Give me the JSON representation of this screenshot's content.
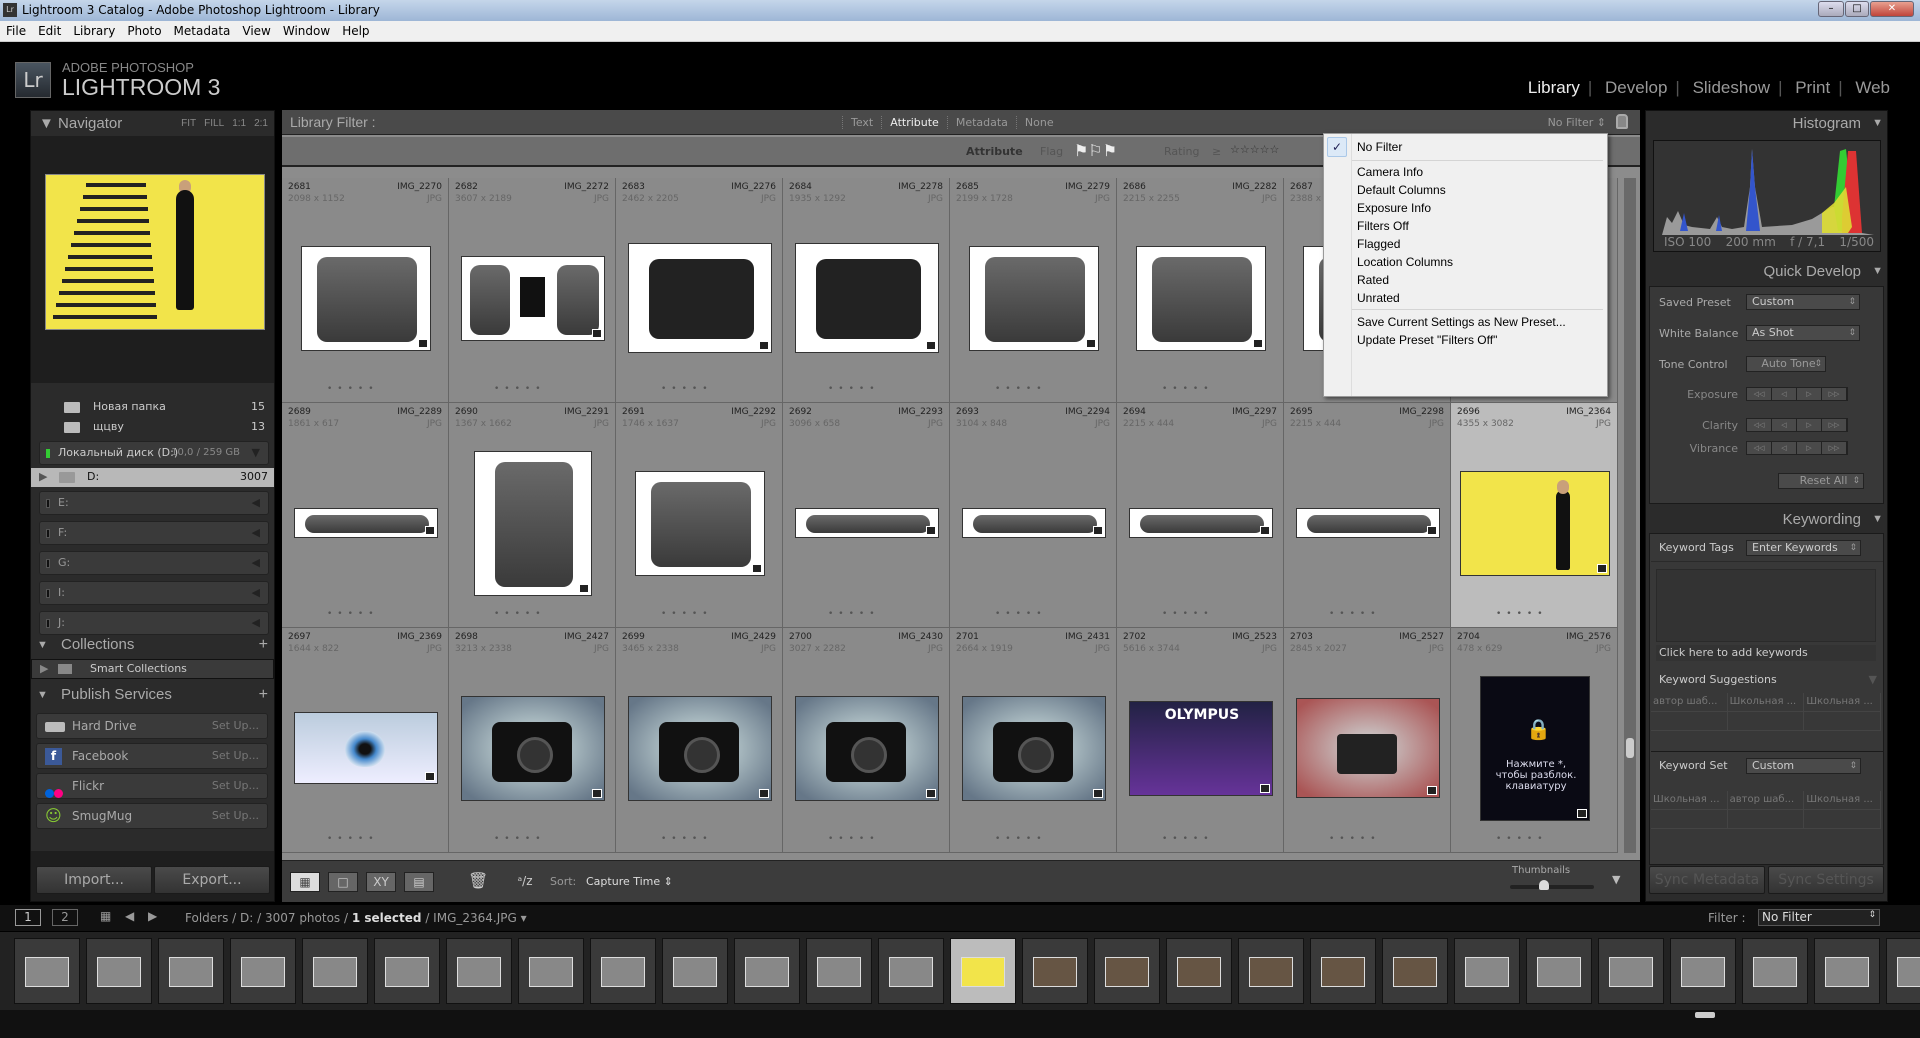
{
  "window": {
    "title": "Lightroom 3 Catalog - Adobe Photoshop Lightroom - Library",
    "icon": "Lr"
  },
  "menubar": [
    "File",
    "Edit",
    "Library",
    "Photo",
    "Metadata",
    "View",
    "Window",
    "Help"
  ],
  "brand": {
    "logo": "Lr",
    "line1": "ADOBE PHOTOSHOP",
    "line2": "LIGHTROOM 3"
  },
  "modules": [
    {
      "label": "Library",
      "active": true
    },
    {
      "label": "Develop"
    },
    {
      "label": "Slideshow"
    },
    {
      "label": "Print"
    },
    {
      "label": "Web"
    }
  ],
  "navigator": {
    "title": "Navigator",
    "zoom": [
      "FIT",
      "FILL",
      "1:1",
      "2:1"
    ]
  },
  "folders": [
    {
      "label": "Новая папка",
      "count": "15"
    },
    {
      "label": "щцву",
      "count": "13"
    }
  ],
  "volume": {
    "label": "Локальный диск (D:)",
    "space": "10,0 / 259 GB"
  },
  "folder_d": {
    "label": "D:",
    "count": "3007"
  },
  "drives": [
    "E:",
    "F:",
    "G:",
    "I:",
    "J:"
  ],
  "collections": {
    "title": "Collections",
    "items": [
      "Smart Collections"
    ]
  },
  "publish": {
    "title": "Publish Services",
    "setup": "Set Up...",
    "items": [
      "Hard Drive",
      "Facebook",
      "Flickr",
      "SmugMug"
    ]
  },
  "left_buttons": {
    "import": "Import...",
    "export": "Export..."
  },
  "filter": {
    "title": "Library Filter :",
    "tabs": [
      "Text",
      "Attribute",
      "Metadata",
      "None"
    ],
    "active_tab": "Attribute",
    "preset": "No Filter",
    "attribute_label": "Attribute",
    "flag_label": "Flag",
    "rating_label": "Rating",
    "rating_op": "≥"
  },
  "filter_menu": {
    "checked": "No Filter",
    "items": [
      "No Filter",
      "Camera Info",
      "Default Columns",
      "Exposure Info",
      "Filters Off",
      "Flagged",
      "Location Columns",
      "Rated",
      "Unrated",
      "Save Current Settings as New Preset...",
      "Update Preset \"Filters Off\""
    ]
  },
  "grid": [
    {
      "index": "2681",
      "name": "IMG_2270",
      "dims": "2098 x 1152",
      "ext": "JPG",
      "kind": "phone-back"
    },
    {
      "index": "2682",
      "name": "IMG_2272",
      "dims": "3607 x 2189",
      "ext": "JPG",
      "kind": "phone-parts"
    },
    {
      "index": "2683",
      "name": "IMG_2276",
      "dims": "2462 x 2205",
      "ext": "JPG",
      "kind": "phone-front"
    },
    {
      "index": "2684",
      "name": "IMG_2278",
      "dims": "1935 x 1292",
      "ext": "JPG",
      "kind": "phone-front"
    },
    {
      "index": "2685",
      "name": "IMG_2279",
      "dims": "2199 x 1728",
      "ext": "JPG",
      "kind": "phone-back"
    },
    {
      "index": "2686",
      "name": "IMG_2282",
      "dims": "2215 x 2255",
      "ext": "JPG",
      "kind": "phone-back"
    },
    {
      "index": "2687",
      "name": "",
      "dims": "2388 x",
      "ext": "",
      "kind": "phone-back"
    },
    {
      "index": "",
      "name": "",
      "dims": "",
      "ext": "",
      "kind": "none"
    },
    {
      "index": "2689",
      "name": "IMG_2289",
      "dims": "1861 x 617",
      "ext": "JPG",
      "kind": "phone-side"
    },
    {
      "index": "2690",
      "name": "IMG_2291",
      "dims": "1367 x 1662",
      "ext": "JPG",
      "kind": "phone-tall"
    },
    {
      "index": "2691",
      "name": "IMG_2292",
      "dims": "1746 x 1637",
      "ext": "JPG",
      "kind": "phone-back"
    },
    {
      "index": "2692",
      "name": "IMG_2293",
      "dims": "3096 x 658",
      "ext": "JPG",
      "kind": "phone-side"
    },
    {
      "index": "2693",
      "name": "IMG_2294",
      "dims": "3104 x 848",
      "ext": "JPG",
      "kind": "phone-side"
    },
    {
      "index": "2694",
      "name": "IMG_2297",
      "dims": "2215 x 444",
      "ext": "JPG",
      "kind": "phone-side"
    },
    {
      "index": "2695",
      "name": "IMG_2298",
      "dims": "2215 x 444",
      "ext": "JPG",
      "kind": "phone-side"
    },
    {
      "index": "2696",
      "name": "IMG_2364",
      "dims": "4355 x 3082",
      "ext": "JPG",
      "kind": "yellow",
      "selected": true
    },
    {
      "index": "2697",
      "name": "IMG_2369",
      "dims": "1644 x 822",
      "ext": "JPG",
      "kind": "eye"
    },
    {
      "index": "2698",
      "name": "IMG_2427",
      "dims": "3213 x 2338",
      "ext": "JPG",
      "kind": "camera"
    },
    {
      "index": "2699",
      "name": "IMG_2429",
      "dims": "3465 x 2338",
      "ext": "JPG",
      "kind": "camera"
    },
    {
      "index": "2700",
      "name": "IMG_2430",
      "dims": "3027 x 2282",
      "ext": "JPG",
      "kind": "camera"
    },
    {
      "index": "2701",
      "name": "IMG_2431",
      "dims": "2664 x 1919",
      "ext": "JPG",
      "kind": "camera"
    },
    {
      "index": "2702",
      "name": "IMG_2523",
      "dims": "5616 x 3744",
      "ext": "JPG",
      "kind": "olympus",
      "caption": "OLYMPUS"
    },
    {
      "index": "2703",
      "name": "IMG_2527",
      "dims": "2845 x 2027",
      "ext": "JPG",
      "kind": "camera-table"
    },
    {
      "index": "2704",
      "name": "IMG_2576",
      "dims": "478 x 629",
      "ext": "JPG",
      "kind": "lockscreen",
      "caption": "Нажмите *, чтобы разблок. клавиатуру"
    }
  ],
  "toolbar": {
    "sort_label": "Sort:",
    "sort_value": "Capture Time",
    "thumbnails_label": "Thumbnails",
    "thumbnail_size": 0.4
  },
  "histogram": {
    "title": "Histogram",
    "iso": "ISO 100",
    "focal": "200 mm",
    "aperture": "f / 7,1",
    "shutter": "1/500"
  },
  "quick_develop": {
    "title": "Quick Develop",
    "saved_preset_label": "Saved Preset",
    "saved_preset": "Custom",
    "wb_label": "White Balance",
    "wb": "As Shot",
    "tone_label": "Tone Control",
    "auto_tone": "Auto Tone",
    "exposure": "Exposure",
    "clarity": "Clarity",
    "vibrance": "Vibrance",
    "reset": "Reset All"
  },
  "keywording": {
    "title": "Keywording",
    "tags_label": "Keyword Tags",
    "tags_mode": "Enter Keywords",
    "add_placeholder": "Click here to add keywords",
    "suggestions_label": "Keyword Suggestions",
    "suggestions": [
      "автор шаб...",
      "Школьная ...",
      "Школьная ..."
    ],
    "set_label": "Keyword Set",
    "set_value": "Custom",
    "set_items": [
      "Школьная ...",
      "автор шаб...",
      "Школьная ..."
    ]
  },
  "sync": {
    "metadata": "Sync Metadata",
    "settings": "Sync Settings"
  },
  "statusbar": {
    "screen1": "1",
    "screen2": "2",
    "path_prefix": "Folders / D: / 3007 photos / ",
    "selected": "1 selected",
    "path_suffix": " / IMG_2364.JPG",
    "filter_label": "Filter :",
    "filter_value": "No Filter"
  },
  "colors": {
    "accent_selected": "#bcbcbc",
    "panel": "#2b2b2b",
    "grid": "#8a8a8a",
    "menu_bg": "#f0f0f0"
  }
}
